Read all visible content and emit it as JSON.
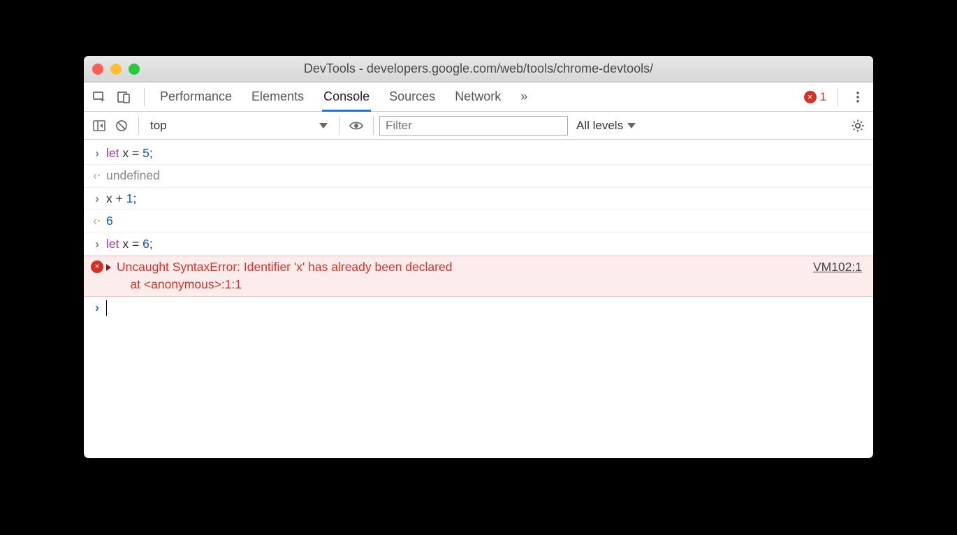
{
  "window": {
    "title": "DevTools - developers.google.com/web/tools/chrome-devtools/"
  },
  "tabs": {
    "items": [
      "Performance",
      "Elements",
      "Console",
      "Sources",
      "Network"
    ],
    "active_index": 2,
    "overflow_label": "»"
  },
  "error_count": {
    "symbol": "×",
    "count": "1"
  },
  "console_toolbar": {
    "context": "top",
    "filter_placeholder": "Filter",
    "log_level": "All levels"
  },
  "console": {
    "lines": [
      {
        "kind": "input",
        "let": "let",
        "var": "x",
        "eq": "=",
        "num": "5",
        "end": ";"
      },
      {
        "kind": "output",
        "text": "undefined"
      },
      {
        "kind": "input_expr",
        "lhs": "x + ",
        "num": "1",
        "end": ";"
      },
      {
        "kind": "output_num",
        "text": "6"
      },
      {
        "kind": "input",
        "let": "let",
        "var": "x",
        "eq": "=",
        "num": "6",
        "end": ";"
      }
    ],
    "error": {
      "message": "Uncaught SyntaxError: Identifier 'x' has already been declared",
      "stack": "    at <anonymous>:1:1",
      "link": "VM102:1"
    }
  }
}
